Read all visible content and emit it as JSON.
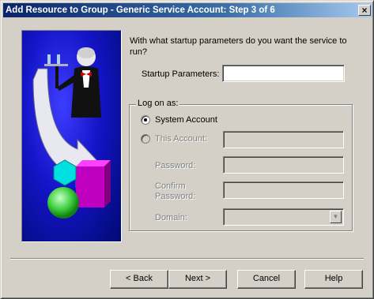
{
  "window": {
    "title": "Add Resource to Group - Generic Service Account:  Step 3 of 6",
    "close_glyph": "×"
  },
  "prompt": "With what startup parameters do you want the service to run?",
  "startup": {
    "label": "Startup Parameters:",
    "value": ""
  },
  "logon": {
    "legend": "Log on as:",
    "system_account": {
      "label": "System Account",
      "selected": true
    },
    "this_account": {
      "label": "This Account:",
      "selected": false,
      "value": ""
    },
    "password": {
      "label": "Password:",
      "value": ""
    },
    "confirm_password": {
      "label": "Confirm\nPassword:",
      "value": ""
    },
    "domain": {
      "label": "Domain:",
      "value": "",
      "arrow": "▼"
    }
  },
  "buttons": {
    "back": "< Back",
    "next": "Next >",
    "cancel": "Cancel",
    "help": "Help"
  },
  "colors": {
    "titlebar_start": "#0a246a",
    "titlebar_end": "#a6caf0",
    "face": "#d4d0c8",
    "art_blue": "#1414c8"
  },
  "icons": [
    "close-icon",
    "wizard-illustration",
    "chevron-down-icon"
  ]
}
